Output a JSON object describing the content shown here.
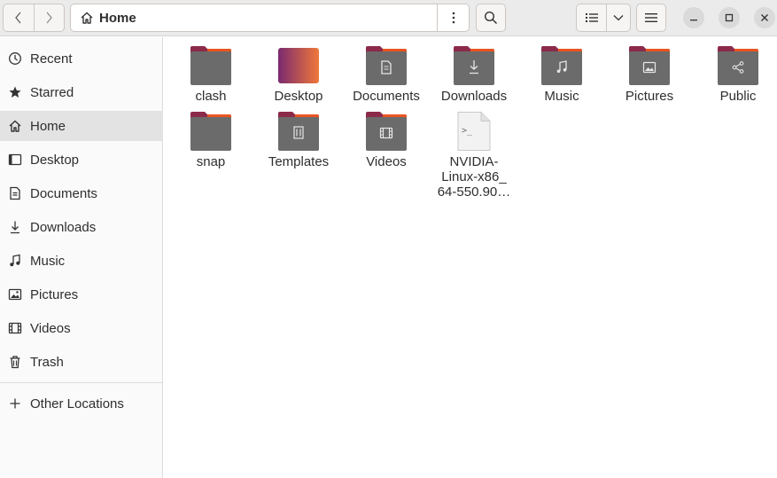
{
  "header": {
    "back_icon": "chevron-left-icon",
    "forward_icon": "chevron-right-icon",
    "path_home_icon": "home-icon",
    "path_label": "Home",
    "path_menu_icon": "vertical-dots-icon",
    "search_icon": "search-icon",
    "view_list_icon": "list-view-icon",
    "view_dropdown_icon": "chevron-down-icon",
    "main_menu_icon": "hamburger-menu-icon",
    "minimize_icon": "minimize-icon",
    "maximize_icon": "maximize-icon",
    "close_icon": "close-icon"
  },
  "sidebar": {
    "items": [
      {
        "label": "Recent",
        "icon": "clock-icon"
      },
      {
        "label": "Starred",
        "icon": "star-icon"
      },
      {
        "label": "Home",
        "icon": "home-icon",
        "active": true
      },
      {
        "label": "Desktop",
        "icon": "desktop-icon"
      },
      {
        "label": "Documents",
        "icon": "document-icon"
      },
      {
        "label": "Downloads",
        "icon": "download-icon"
      },
      {
        "label": "Music",
        "icon": "music-icon"
      },
      {
        "label": "Pictures",
        "icon": "picture-icon"
      },
      {
        "label": "Videos",
        "icon": "video-icon"
      },
      {
        "label": "Trash",
        "icon": "trash-icon"
      }
    ],
    "other_locations": {
      "label": "Other Locations",
      "icon": "plus-icon"
    }
  },
  "files": [
    {
      "name": "clash",
      "icon": "folder-icon"
    },
    {
      "name": "Desktop",
      "icon": "desktop-folder-icon"
    },
    {
      "name": "Documents",
      "icon": "documents-folder-icon"
    },
    {
      "name": "Downloads",
      "icon": "downloads-folder-icon"
    },
    {
      "name": "Music",
      "icon": "music-folder-icon"
    },
    {
      "name": "Pictures",
      "icon": "pictures-folder-icon"
    },
    {
      "name": "Public",
      "icon": "public-folder-icon"
    },
    {
      "name": "snap",
      "icon": "folder-icon"
    },
    {
      "name": "Templates",
      "icon": "templates-folder-icon"
    },
    {
      "name": "Videos",
      "icon": "videos-folder-icon"
    },
    {
      "name": "NVIDIA-Linux-x86_64-550.90…",
      "name_lines": [
        "NVIDIA-",
        "Linux-x86_",
        "64-550.90…"
      ],
      "icon": "script-file-icon"
    }
  ],
  "colors": {
    "folder_body": "#6b6b6b",
    "folder_tab": "#8c2a4a",
    "folder_accent": "#e95420",
    "desktop_gradient_start": "#7a2a6f",
    "desktop_gradient_end": "#f0783a"
  }
}
